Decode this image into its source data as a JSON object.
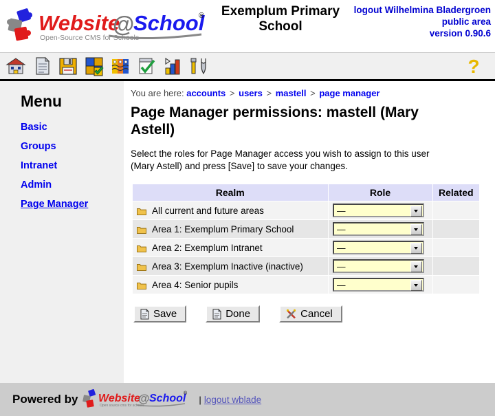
{
  "header": {
    "logo_text": "Website@School",
    "logo_tagline": "Open-Source CMS for Schools",
    "logo_registered": "®",
    "school_name": "Exemplum Primary School",
    "logout_user": "logout Wilhelmina Bladergroen",
    "area": "public area",
    "version": "version 0.90.6"
  },
  "toolbar": {
    "icons": [
      {
        "name": "home-icon",
        "title": "Home"
      },
      {
        "name": "page-icon",
        "title": "Pages"
      },
      {
        "name": "save-disk-icon",
        "title": "Save"
      },
      {
        "name": "modules-icon",
        "title": "Modules"
      },
      {
        "name": "groups-icon",
        "title": "Groups"
      },
      {
        "name": "tasks-icon",
        "title": "Tasks"
      },
      {
        "name": "statistics-icon",
        "title": "Statistics"
      },
      {
        "name": "tools-icon",
        "title": "Tools"
      }
    ],
    "help_label": "?"
  },
  "sidebar": {
    "title": "Menu",
    "items": [
      {
        "label": "Basic",
        "current": false
      },
      {
        "label": "Groups",
        "current": false
      },
      {
        "label": "Intranet",
        "current": false
      },
      {
        "label": "Admin",
        "current": false
      },
      {
        "label": "Page Manager",
        "current": true
      }
    ]
  },
  "breadcrumb": {
    "prefix": "You are here:",
    "separator": ">",
    "items": [
      "accounts",
      "users",
      "mastell",
      "page manager"
    ]
  },
  "main": {
    "page_title": "Page Manager permissions: mastell (Mary Astell)",
    "intro": "Select the roles for Page Manager access you wish to assign to this user (Mary Astell) and press [Save] to save your changes.",
    "table": {
      "columns": [
        "Realm",
        "Role",
        "Related"
      ],
      "rows": [
        {
          "realm": "All current and future areas",
          "role": "—",
          "related": ""
        },
        {
          "realm": "Area 1: Exemplum Primary School",
          "role": "—",
          "related": ""
        },
        {
          "realm": "Area 2: Exemplum Intranet",
          "role": "—",
          "related": ""
        },
        {
          "realm": "Area 3: Exemplum Inactive (inactive)",
          "role": "—",
          "related": ""
        },
        {
          "realm": "Area 4: Senior pupils",
          "role": "—",
          "related": ""
        }
      ],
      "role_options": [
        "—"
      ]
    },
    "buttons": [
      {
        "label": "Save",
        "icon": "document-icon"
      },
      {
        "label": "Done",
        "icon": "document-icon"
      },
      {
        "label": "Cancel",
        "icon": "cross-tools-icon"
      }
    ]
  },
  "footer": {
    "powered_by": "Powered by",
    "logo_text": "Website@School",
    "logo_tagline": "Open source cms for schools",
    "separator": "|",
    "logout_link": "logout wblade"
  },
  "colors": {
    "link": "#0000ee",
    "header_blue": "#0000d0",
    "table_header": "#ddddf8",
    "row_odd": "#f3f3f3",
    "row_even": "#e6e6e6",
    "select_bg": "#ffffcc",
    "footer_bg": "#cccccc",
    "sidebar_bg": "#f0f0f0"
  }
}
